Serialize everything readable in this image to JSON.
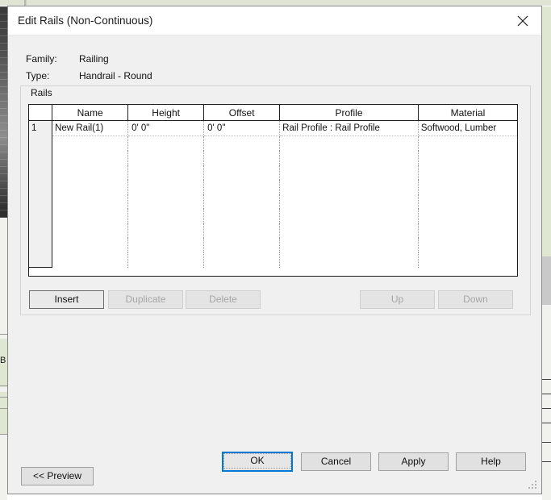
{
  "window": {
    "title": "Edit Rails (Non-Continuous)",
    "close_icon": "close-icon"
  },
  "form": {
    "family_label": "Family:",
    "family_value": "Railing",
    "type_label": "Type:",
    "type_value": "Handrail - Round"
  },
  "group": {
    "label": "Rails"
  },
  "table": {
    "columns": [
      "",
      "Name",
      "Height",
      "Offset",
      "Profile",
      "Material"
    ],
    "rows": [
      {
        "index": "1",
        "name": "New Rail(1)",
        "height": "0'  0\"",
        "offset": "0'  0\"",
        "profile": "Rail Profile : Rail Profile",
        "material": "Softwood, Lumber"
      }
    ],
    "empty_row_count": 9
  },
  "row_actions": {
    "insert": "Insert",
    "duplicate": "Duplicate",
    "delete": "Delete",
    "up": "Up",
    "down": "Down"
  },
  "footer": {
    "preview": "<< Preview",
    "ok": "OK",
    "cancel": "Cancel",
    "apply": "Apply",
    "help": "Help"
  },
  "colors": {
    "focus_border": "#0078d4",
    "dialog_background": "#f0f0f0",
    "titlebar_background": "#ffffff",
    "grid_border": "#1e1e1e"
  },
  "background": {
    "left_edge_text": "B"
  }
}
